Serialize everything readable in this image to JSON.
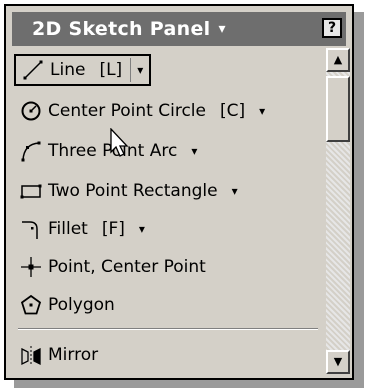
{
  "panel": {
    "title": "2D Sketch Panel",
    "title_dropdown_glyph": "▾",
    "help_label": "?"
  },
  "items": [
    {
      "label": "Line",
      "shortcut": "[L]",
      "icon": "line-icon"
    },
    {
      "label": "Center Point Circle",
      "shortcut": "[C]",
      "icon": "circle-icon"
    },
    {
      "label": "Three Point Arc",
      "shortcut": "",
      "icon": "arc-icon"
    },
    {
      "label": "Two Point Rectangle",
      "shortcut": "",
      "icon": "rectangle-icon"
    },
    {
      "label": "Fillet",
      "shortcut": "[F]",
      "icon": "fillet-icon"
    },
    {
      "label": "Point, Center Point",
      "shortcut": "",
      "icon": "point-icon"
    },
    {
      "label": "Polygon",
      "shortcut": "",
      "icon": "polygon-icon"
    },
    {
      "label": "Mirror",
      "shortcut": "",
      "icon": "mirror-icon"
    }
  ],
  "dropdown_glyph": "▾",
  "scrollbar": {
    "up": "▲",
    "down": "▼"
  },
  "colors": {
    "titlebar": "#6e6e6e",
    "panel_bg": "#d4d0c8"
  }
}
